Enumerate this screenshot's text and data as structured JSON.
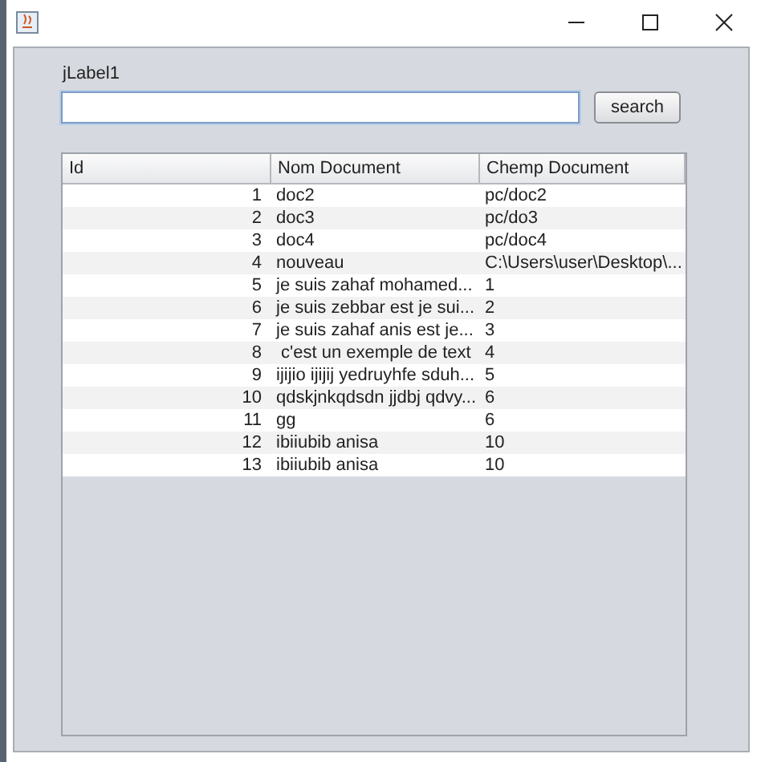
{
  "label": "jLabel1",
  "search_button": "search",
  "table": {
    "columns": [
      "Id",
      "Nom Document",
      "Chemp Document"
    ],
    "rows": [
      [
        "1",
        "doc2",
        "pc/doc2"
      ],
      [
        "2",
        "doc3",
        "pc/do3"
      ],
      [
        "3",
        "doc4",
        "pc/doc4"
      ],
      [
        "4",
        "nouveau",
        "C:\\Users\\user\\Desktop\\..."
      ],
      [
        "5",
        "je suis zahaf mohamed...",
        "1"
      ],
      [
        "6",
        "je suis zebbar est je sui...",
        "2"
      ],
      [
        "7",
        "je suis zahaf anis est je...",
        "3"
      ],
      [
        "8",
        " c'est un exemple de text",
        "4"
      ],
      [
        "9",
        "ijijio ijijij yedruyhfe sduh...",
        "5"
      ],
      [
        "10",
        "qdskjnkqdsdn jjdbj qdvy...",
        "6"
      ],
      [
        "11",
        "gg",
        "6"
      ],
      [
        "12",
        "ibiiubib anisa",
        "10"
      ],
      [
        "13",
        "ibiiubib anisa",
        "10"
      ]
    ]
  }
}
